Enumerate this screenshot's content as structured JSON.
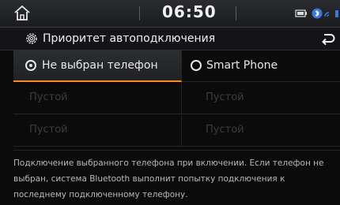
{
  "status_bar": {
    "time": "06:50",
    "icons": [
      "home-icon",
      "battery-icon",
      "bluetooth-icon",
      "signal-icon"
    ]
  },
  "header": {
    "title": "Приоритет автоподключения",
    "icons": [
      "gear-icon",
      "back-arrow-icon"
    ]
  },
  "options": {
    "row1": {
      "left": {
        "label": "Не выбран телефон",
        "selected": true
      },
      "right": {
        "label": "Smart Phone",
        "selected": false
      }
    },
    "row2": {
      "left": "Пустой",
      "right": "Пустой"
    },
    "row3": {
      "left": "Пустой",
      "right": "Пустой"
    }
  },
  "description": "Подключение выбранного телефона при включении. Если телефон не выбран, система Bluetooth выполнит попытку подключения к последнему подключенному телефону.",
  "colors": {
    "accent": "#ff8a1e",
    "background": "#0b0b0c",
    "text": "#e9e9e9",
    "empty_text": "#3b3c3f"
  }
}
